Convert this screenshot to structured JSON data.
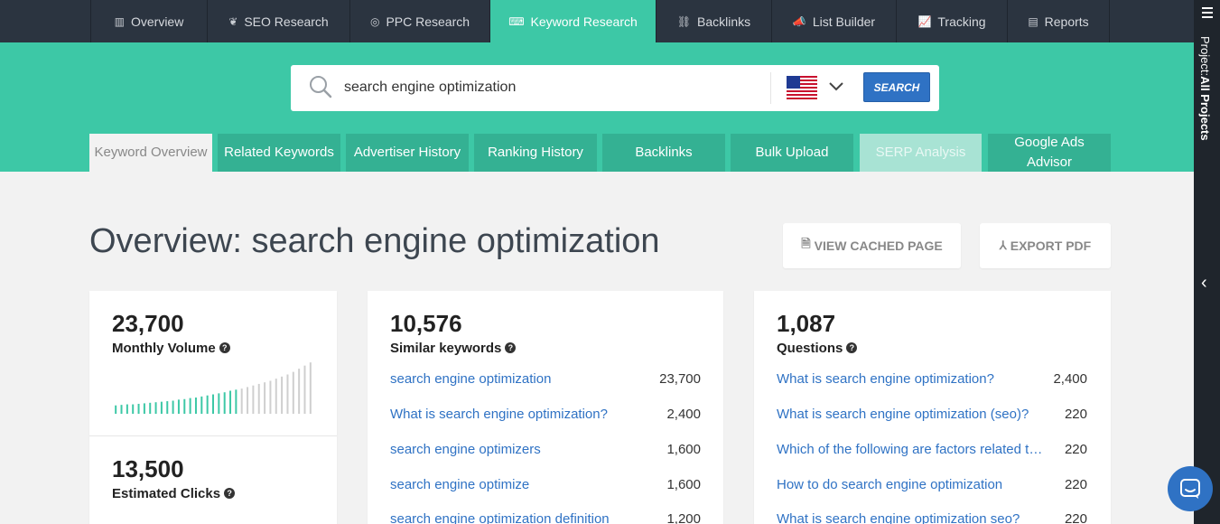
{
  "nav": {
    "items": [
      {
        "label": "Overview",
        "icon": "bar-chart-icon",
        "glyph": "▥"
      },
      {
        "label": "SEO Research",
        "icon": "leaf-icon",
        "glyph": "❦"
      },
      {
        "label": "PPC Research",
        "icon": "target-icon",
        "glyph": "◎"
      },
      {
        "label": "Keyword Research",
        "icon": "keyboard-icon",
        "glyph": "⌨"
      },
      {
        "label": "Backlinks",
        "icon": "link-icon",
        "glyph": "⛓"
      },
      {
        "label": "List Builder",
        "icon": "megaphone-icon",
        "glyph": "📣"
      },
      {
        "label": "Tracking",
        "icon": "line-chart-icon",
        "glyph": "📈"
      },
      {
        "label": "Reports",
        "icon": "document-icon",
        "glyph": "▤"
      }
    ],
    "active": "Keyword Research"
  },
  "sidebar": {
    "project_label": "Project:",
    "project_value": "All Projects"
  },
  "search": {
    "query": "search engine optimization",
    "country": "US",
    "button_label": "SEARCH"
  },
  "tabs": [
    {
      "label": "Keyword Overview",
      "state": "active"
    },
    {
      "label": "Related Keywords",
      "state": "normal"
    },
    {
      "label": "Advertiser History",
      "state": "normal"
    },
    {
      "label": "Ranking History",
      "state": "normal"
    },
    {
      "label": "Backlinks",
      "state": "normal"
    },
    {
      "label": "Bulk Upload",
      "state": "normal"
    },
    {
      "label": "SERP Analysis",
      "state": "disabled"
    },
    {
      "label": "Google Ads Advisor",
      "state": "normal"
    }
  ],
  "page": {
    "title": "Overview: search engine optimization",
    "view_cached_label": "VIEW CACHED PAGE",
    "export_pdf_label": "EXPORT PDF"
  },
  "volume_card": {
    "monthly_volume": "23,700",
    "monthly_volume_label": "Monthly Volume",
    "estimated_clicks": "13,500",
    "estimated_clicks_label": "Estimated Clicks",
    "trend": [
      0.16,
      0.17,
      0.18,
      0.18,
      0.19,
      0.2,
      0.21,
      0.22,
      0.23,
      0.24,
      0.25,
      0.27,
      0.28,
      0.3,
      0.31,
      0.33,
      0.35,
      0.37,
      0.39,
      0.41,
      0.44,
      0.46,
      0.48,
      0.51,
      0.54,
      0.57,
      0.6,
      0.63,
      0.67,
      0.71,
      0.75,
      0.8,
      0.86,
      0.92,
      0.98
    ],
    "trend_colors": {
      "recent": "#3dc8a6",
      "older": "#cfcfcf"
    },
    "recent_count": 22
  },
  "similar_card": {
    "count": "10,576",
    "label": "Similar keywords",
    "rows": [
      {
        "keyword": "search engine optimization",
        "volume": "23,700"
      },
      {
        "keyword": "What is search engine optimization?",
        "volume": "2,400"
      },
      {
        "keyword": "search engine optimizers",
        "volume": "1,600"
      },
      {
        "keyword": "search engine optimize",
        "volume": "1,600"
      },
      {
        "keyword": "search engine optimization definition",
        "volume": "1,200"
      }
    ]
  },
  "questions_card": {
    "count": "1,087",
    "label": "Questions",
    "rows": [
      {
        "keyword": "What is search engine optimization?",
        "volume": "2,400"
      },
      {
        "keyword": "What is search engine optimization (seo)?",
        "volume": "220"
      },
      {
        "keyword": "Which of the following are factors related to search engine optimization?",
        "volume": "220"
      },
      {
        "keyword": "How to do search engine optimization",
        "volume": "220"
      },
      {
        "keyword": "What is search engine optimization seo?",
        "volume": "220"
      }
    ]
  }
}
